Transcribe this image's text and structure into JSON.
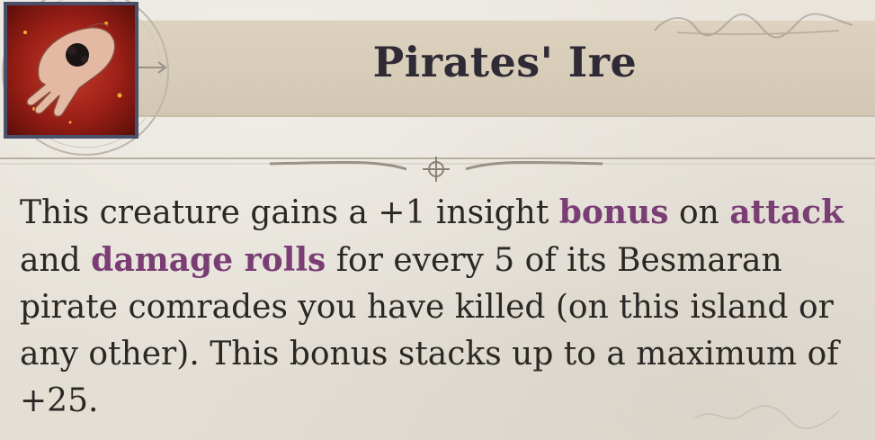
{
  "ability": {
    "title": "Pirates' Ire",
    "icon": "palm-with-dark-mark-icon",
    "description": {
      "p1": "This creature gains a +1 insight ",
      "k1": "bonus",
      "p2": " on ",
      "k2": "attack",
      "p3": " and ",
      "k3": "damage rolls",
      "p4": " for every 5 of its Besmaran pirate comrades you have killed (on this island or any other). This bonus stacks up to a maximum of +25."
    }
  },
  "colors": {
    "parchment": "#e6e1d8",
    "title_band": "#d7ccb8",
    "title_text": "#2e2b36",
    "keyword": "#7a3d74",
    "body_text": "#2a2725",
    "icon_frame": "#4a4f6a",
    "icon_background": "#9a1f16"
  }
}
